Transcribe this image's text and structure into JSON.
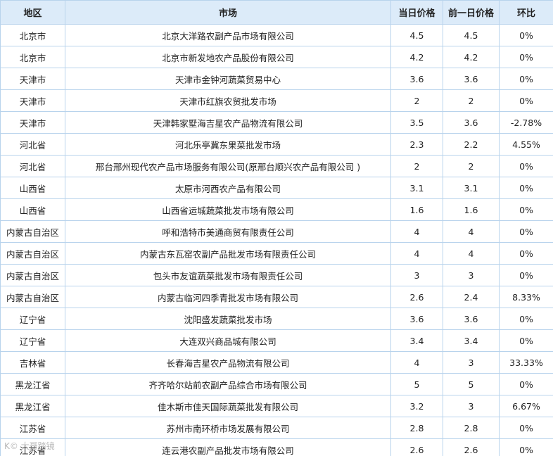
{
  "table": {
    "headers": [
      "地区",
      "市场",
      "当日价格",
      "前一日价格",
      "环比"
    ],
    "rows": [
      [
        "北京市",
        "北京大洋路农副产品市场有限公司",
        "4.5",
        "4.5",
        "0%"
      ],
      [
        "北京市",
        "北京市新发地农产品股份有限公司",
        "4.2",
        "4.2",
        "0%"
      ],
      [
        "天津市",
        "天津市金钟河蔬菜贸易中心",
        "3.6",
        "3.6",
        "0%"
      ],
      [
        "天津市",
        "天津市红旗农贸批发市场",
        "2",
        "2",
        "0%"
      ],
      [
        "天津市",
        "天津韩家墅海吉星农产品物流有限公司",
        "3.5",
        "3.6",
        "-2.78%"
      ],
      [
        "河北省",
        "河北乐亭冀东果菜批发市场",
        "2.3",
        "2.2",
        "4.55%"
      ],
      [
        "河北省",
        "邢台邢州现代农产品市场服务有限公司(原邢台顺兴农产品有限公司 )",
        "2",
        "2",
        "0%"
      ],
      [
        "山西省",
        "太原市河西农产品有限公司",
        "3.1",
        "3.1",
        "0%"
      ],
      [
        "山西省",
        "山西省运城蔬菜批发市场有限公司",
        "1.6",
        "1.6",
        "0%"
      ],
      [
        "内蒙古自治区",
        "呼和浩特市美通商贸有限责任公司",
        "4",
        "4",
        "0%"
      ],
      [
        "内蒙古自治区",
        "内蒙古东瓦窑农副产品批发市场有限责任公司",
        "4",
        "4",
        "0%"
      ],
      [
        "内蒙古自治区",
        "包头市友谊蔬菜批发市场有限责任公司",
        "3",
        "3",
        "0%"
      ],
      [
        "内蒙古自治区",
        "内蒙古临河四季青批发市场有限公司",
        "2.6",
        "2.4",
        "8.33%"
      ],
      [
        "辽宁省",
        "沈阳盛发蔬菜批发市场",
        "3.6",
        "3.6",
        "0%"
      ],
      [
        "辽宁省",
        "大连双兴商品城有限公司",
        "3.4",
        "3.4",
        "0%"
      ],
      [
        "吉林省",
        "长春海吉星农产品物流有限公司",
        "4",
        "3",
        "33.33%"
      ],
      [
        "黑龙江省",
        "齐齐哈尔站前农副产品综合市场有限公司",
        "5",
        "5",
        "0%"
      ],
      [
        "黑龙江省",
        "佳木斯市佳天国际蔬菜批发有限公司",
        "3.2",
        "3",
        "6.67%"
      ],
      [
        "江苏省",
        "苏州市南环桥市场发展有限公司",
        "2.8",
        "2.8",
        "0%"
      ],
      [
        "江苏省",
        "连云港农副产品批发市场有限公司",
        "2.6",
        "2.6",
        "0%"
      ]
    ]
  },
  "watermark": "K© 大哥踏镜"
}
